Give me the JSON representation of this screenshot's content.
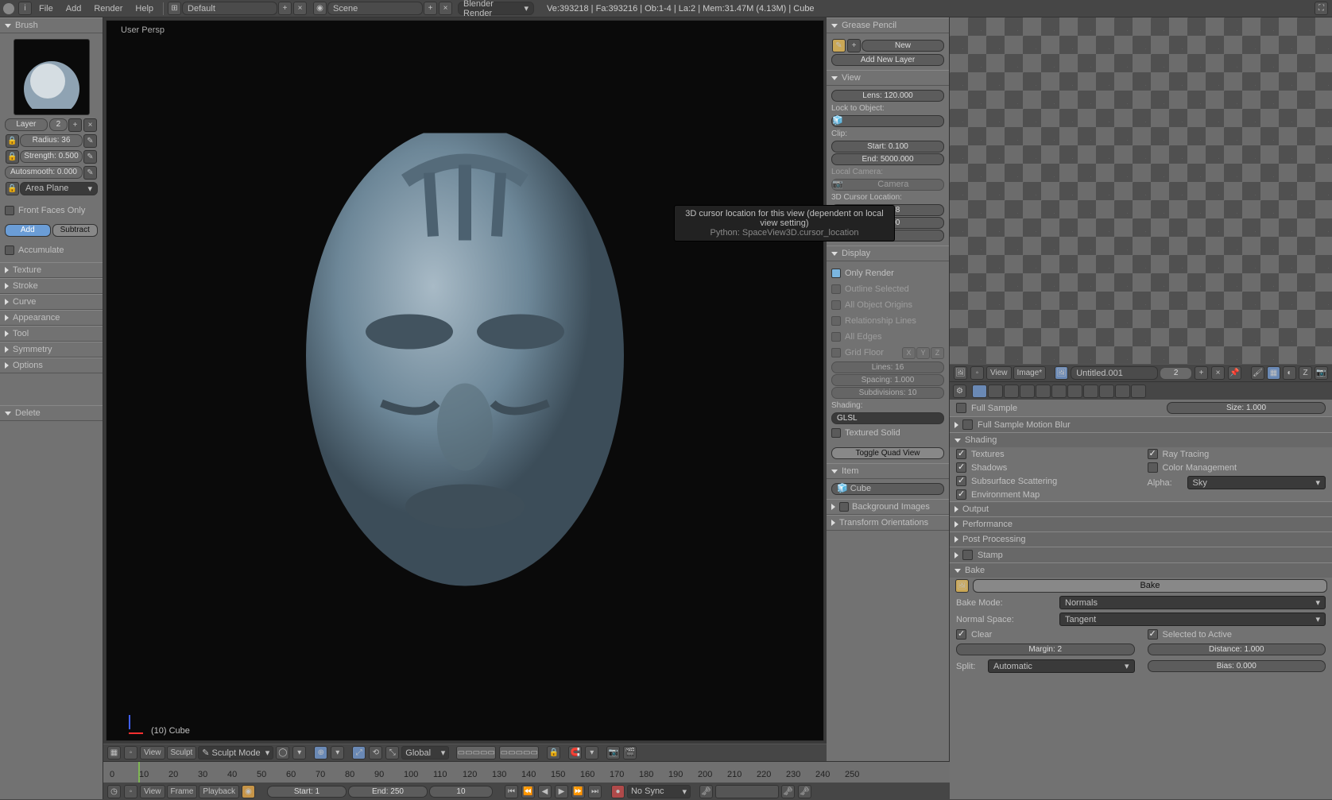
{
  "topbar": {
    "menus": [
      "File",
      "Add",
      "Render",
      "Help"
    ],
    "layout": "Default",
    "scene": "Scene",
    "engine": "Blender Render",
    "stats": "Ve:393218 | Fa:393216 | Ob:1-4 | La:2 | Mem:31.47M (4.13M) | Cube"
  },
  "brush": {
    "header": "Brush",
    "layer_label": "Layer",
    "layer_value": "2",
    "radius": "Radius: 36",
    "strength": "Strength: 0.500",
    "autosmooth": "Autosmooth: 0.000",
    "plane": "Area Plane",
    "front_faces": "Front Faces Only",
    "add": "Add",
    "subtract": "Subtract",
    "accumulate": "Accumulate"
  },
  "left_collapsed": [
    "Texture",
    "Stroke",
    "Curve",
    "Appearance",
    "Tool",
    "Symmetry",
    "Options"
  ],
  "left_delete": "Delete",
  "viewport": {
    "persp": "User Persp",
    "obj": "(10) Cube",
    "view": "View",
    "sculpt": "Sculpt",
    "mode": "Sculpt Mode",
    "transform": "Global"
  },
  "n_panel": {
    "gp": "Grease Pencil",
    "gp_new": "New",
    "gp_add": "Add New Layer",
    "view": "View",
    "lens": "Lens: 120.000",
    "lock": "Lock to Object:",
    "clip": "Clip:",
    "clip_start": "Start: 0.100",
    "clip_end": "End: 5000.000",
    "local_cam": "Local Camera:",
    "camera": "Camera",
    "cursor_loc": "3D Cursor Location:",
    "cx": "4.5978",
    "cy": "6.3790",
    "display": "Display",
    "only_render": "Only Render",
    "outline": "Outline Selected",
    "origins": "All Object Origins",
    "rel_lines": "Relationship Lines",
    "all_edges": "All Edges",
    "grid_floor": "Grid Floor",
    "lines": "Lines: 16",
    "spacing": "Spacing: 1.000",
    "subdiv": "Subdivisions: 10",
    "shading": "Shading:",
    "glsl": "GLSL",
    "tex_solid": "Textured Solid",
    "toggle_quad": "Toggle Quad View",
    "item": "Item",
    "item_name": "Cube",
    "bg_images": "Background Images",
    "transform_ori": "Transform Orientations"
  },
  "tooltip": {
    "line1": "3D cursor location for this view (dependent on local view setting)",
    "line2": "Python: SpaceView3D.cursor_location"
  },
  "uv": {
    "view": "View",
    "image": "Image*",
    "name": "Untitled.001",
    "idx": "2"
  },
  "props": {
    "full_sample": "Full Sample",
    "size": "Size: 1.000",
    "fsm_blur": "Full Sample Motion Blur",
    "shading": "Shading",
    "textures": "Textures",
    "shadows": "Shadows",
    "sss": "Subsurface Scattering",
    "envmap": "Environment Map",
    "raytrace": "Ray Tracing",
    "colmgmt": "Color Management",
    "alpha": "Alpha:",
    "alpha_val": "Sky",
    "output": "Output",
    "perf": "Performance",
    "post": "Post Processing",
    "stamp": "Stamp",
    "bake_hdr": "Bake",
    "bake_btn": "Bake",
    "bake_mode": "Bake Mode:",
    "bake_mode_val": "Normals",
    "normal_space": "Normal Space:",
    "normal_space_val": "Tangent",
    "clear": "Clear",
    "sel_active": "Selected to Active",
    "margin": "Margin: 2",
    "distance": "Distance: 1.000",
    "split": "Split:",
    "split_val": "Automatic",
    "bias": "Bias: 0.000"
  },
  "timeline": {
    "view": "View",
    "frame": "Frame",
    "playback": "Playback",
    "start": "Start: 1",
    "end": "End: 250",
    "cur": "10",
    "nosync": "No Sync",
    "nums": [
      "0",
      "10",
      "20",
      "30",
      "40",
      "50",
      "60",
      "70",
      "80",
      "90",
      "100",
      "110",
      "120",
      "130",
      "140",
      "150",
      "160",
      "170",
      "180",
      "190",
      "200",
      "210",
      "220",
      "230",
      "240",
      "250"
    ]
  }
}
